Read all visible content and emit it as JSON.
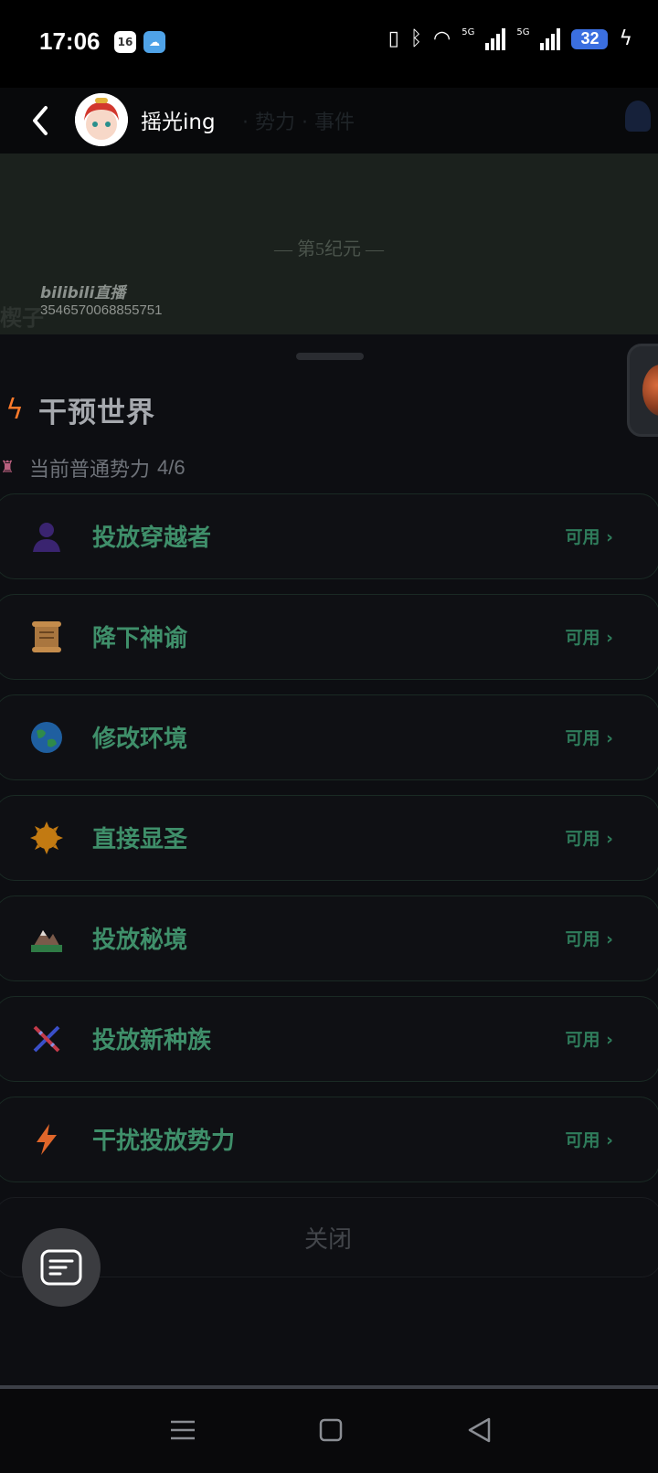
{
  "status_bar": {
    "time": "17:06",
    "calendar_day": "16",
    "battery_level": "32",
    "network_1": "5G",
    "network_2": "5G"
  },
  "topbar": {
    "streamer_name": "摇光ing",
    "ghost_tabs": "· 势力 · 事件"
  },
  "stream": {
    "era_title": "— 第5纪元 —",
    "platform_logo": "bilibili直播",
    "room_id": "3546570068855751",
    "ghost_text": "楔子"
  },
  "sheet": {
    "title": "干预世界",
    "power_label": "当前普通势力",
    "power_count": "4/6",
    "actions": [
      {
        "label": "投放穿越者",
        "status": "可用",
        "icon": "person-icon"
      },
      {
        "label": "降下神谕",
        "status": "可用",
        "icon": "scroll-icon"
      },
      {
        "label": "修改环境",
        "status": "可用",
        "icon": "globe-icon"
      },
      {
        "label": "直接显圣",
        "status": "可用",
        "icon": "sun-icon"
      },
      {
        "label": "投放秘境",
        "status": "可用",
        "icon": "mountain-icon"
      },
      {
        "label": "投放新种族",
        "status": "可用",
        "icon": "dna-icon"
      },
      {
        "label": "干扰投放势力",
        "status": "可用",
        "icon": "lightning-icon"
      }
    ],
    "close_label": "关闭"
  },
  "colors": {
    "accent_green": "#3f8f6a",
    "lightning": "#ff7a2a",
    "background": "#0d0e12"
  }
}
